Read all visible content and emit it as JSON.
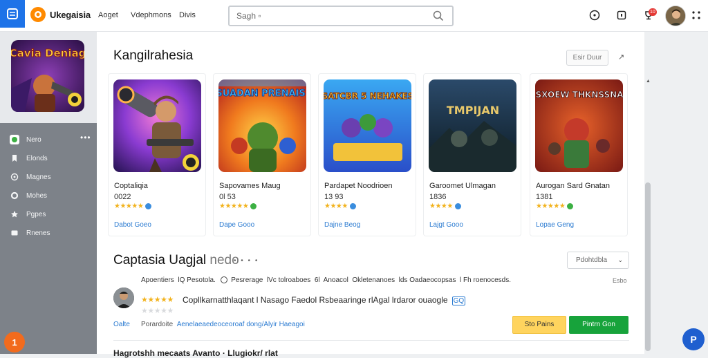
{
  "header": {
    "brand": "Ukegaisia",
    "nav": [
      "Aoget",
      "Vdephmons",
      "Divis"
    ],
    "search_placeholder": "Sagh ▫",
    "notification_count": "10"
  },
  "sidebar": {
    "featured_title": "Cavia Deniag",
    "items": [
      {
        "label": "Nero",
        "icon": "home-icon",
        "active": true
      },
      {
        "label": "Elonds",
        "icon": "bookmark-icon"
      },
      {
        "label": "Magnes",
        "icon": "target-icon"
      },
      {
        "label": "Mohes",
        "icon": "ring-icon"
      },
      {
        "label": "Pgpes",
        "icon": "star-icon"
      },
      {
        "label": "Rnenes",
        "icon": "square-icon"
      }
    ],
    "more": "•••",
    "fab_label": "1"
  },
  "main": {
    "section1": {
      "title": "Kangilrahesia",
      "see_all": "Esir Duur",
      "arrow": "↗",
      "cards": [
        {
          "name": "Coptaliqia",
          "count": "0022",
          "stars": "★★★★★",
          "badge": "#3a8dde",
          "link": "Dabot Goeo",
          "art_title": ""
        },
        {
          "name": "Sapovames Maug",
          "count": "0l 53",
          "stars": "★★★★★",
          "badge": "#3cb043",
          "link": "Dape Gooo",
          "art_title": "SUADAN PRENAIS!"
        },
        {
          "name": "Pardapet Noodrioen",
          "count": "13 93",
          "stars": "★★★★",
          "badge": "#3a8dde",
          "link": "Dajne Beog",
          "art_title": "SATCBR 5 NEHAKES"
        },
        {
          "name": "Garoomet Ulmagan",
          "count": "1836",
          "stars": "★★★★",
          "badge": "#3a8dde",
          "link": "Lajgt Gooo",
          "art_title": "TMPIJAN"
        },
        {
          "name": "Aurogan Sard Gnatan",
          "count": "1381",
          "stars": "★★★★★",
          "badge": "#3cb043",
          "link": "Lopae Geng",
          "art_title": "SXOEW THKNSSNA"
        }
      ]
    },
    "section2": {
      "title": "Captasia Uagjal",
      "title_suffix": "nedo",
      "dots": "• • • •",
      "sort_label": "Pdohtdbla",
      "filters": [
        "Apoentiers",
        "lQ Pesotola.",
        "Pesrerage",
        "lVc tolroaboes",
        "6l",
        "Anoacol",
        "Okletenanoes",
        "lds Oadaeocopsas",
        "l Fh roenocesds."
      ],
      "filters_right": "Esbo",
      "review": {
        "stars": "★★★★★",
        "empty_stars": "★★★★★",
        "text": "Copllkarnatthlaqant l Nasago Faedol Rsbeaaringe rlAgal lrdaror ouaogle",
        "tag": "GQ",
        "link": "Oalte",
        "meta": "Porardoite",
        "meta_link": "Aenelaeaedeoceoroaf dong/Alyir  Haeagoi",
        "btn_secondary": "Sto Pains",
        "btn_primary": "Pintrn Gon"
      },
      "next_row": "Hagrotshh mecaats Avanto · Llugiokr/ rlat"
    }
  },
  "help_label": "P"
}
